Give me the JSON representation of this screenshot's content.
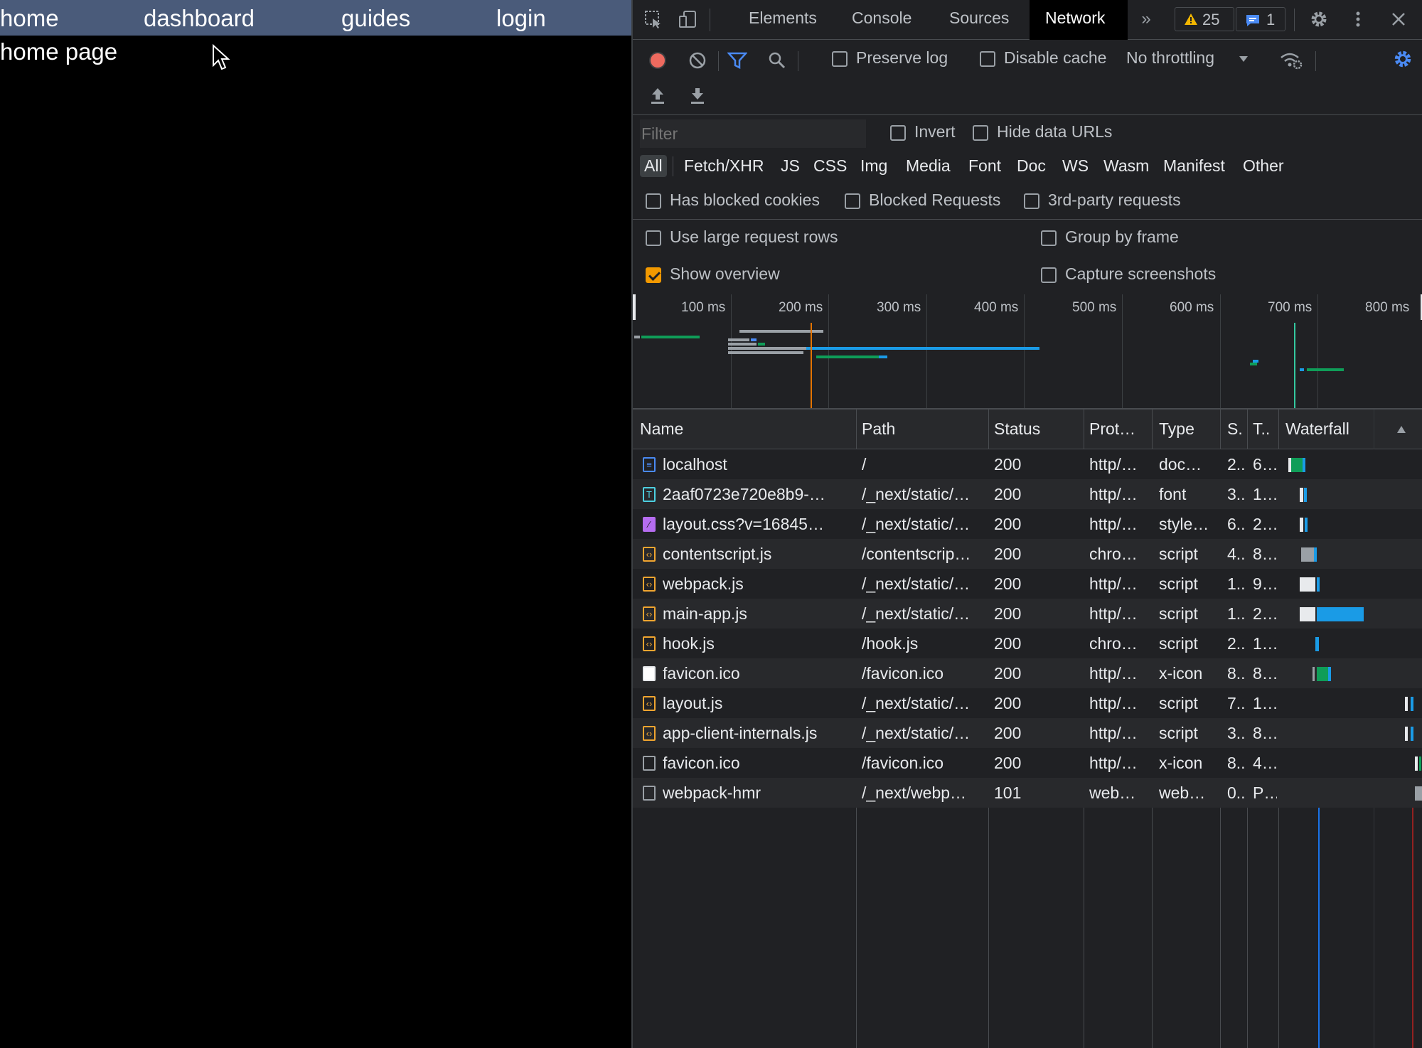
{
  "app": {
    "nav": [
      "home",
      "dashboard",
      "guides",
      "login"
    ],
    "title": "home page"
  },
  "devtools": {
    "tabs": [
      "Elements",
      "Console",
      "Sources",
      "Network"
    ],
    "active_tab": "Network",
    "warnings_count": "25",
    "messages_count": "1",
    "toolbar": {
      "preserve_log": "Preserve log",
      "disable_cache": "Disable cache",
      "throttling": "No throttling"
    },
    "filter": {
      "placeholder": "Filter",
      "invert": "Invert",
      "hide_data_urls": "Hide data URLs"
    },
    "types": [
      "All",
      "Fetch/XHR",
      "JS",
      "CSS",
      "Img",
      "Media",
      "Font",
      "Doc",
      "WS",
      "Wasm",
      "Manifest",
      "Other"
    ],
    "options": {
      "has_blocked_cookies": "Has blocked cookies",
      "blocked_requests": "Blocked Requests",
      "third_party": "3rd-party requests",
      "large_rows": "Use large request rows",
      "group_by_frame": "Group by frame",
      "show_overview": "Show overview",
      "capture_screenshots": "Capture screenshots"
    },
    "overview_ticks": [
      "100 ms",
      "200 ms",
      "300 ms",
      "400 ms",
      "500 ms",
      "600 ms",
      "700 ms",
      "800 ms"
    ],
    "columns": [
      "Name",
      "Path",
      "Status",
      "Prot…",
      "Type",
      "S.",
      "T..",
      "Waterfall"
    ],
    "colors": {
      "doc": "#4a8af4",
      "font": "#4dd0e1",
      "style": "#b56cf0",
      "script": "#f0a530",
      "waiting": "#0f9d58",
      "download": "#1a9be6"
    },
    "requests": [
      {
        "icon": "doc",
        "name": "localhost",
        "path": "/",
        "status": "200",
        "protocol": "http/…",
        "type": "doc…",
        "size": "2..",
        "time": "6…"
      },
      {
        "icon": "font",
        "name": "2aaf0723e720e8b9-…",
        "path": "/_next/static/…",
        "status": "200",
        "protocol": "http/…",
        "type": "font",
        "size": "3..",
        "time": "1…"
      },
      {
        "icon": "style",
        "name": "layout.css?v=16845…",
        "path": "/_next/static/…",
        "status": "200",
        "protocol": "http/…",
        "type": "style…",
        "size": "6..",
        "time": "2…"
      },
      {
        "icon": "script",
        "name": "contentscript.js",
        "path": "/contentscrip…",
        "status": "200",
        "protocol": "chro…",
        "type": "script",
        "size": "4..",
        "time": "8…"
      },
      {
        "icon": "script",
        "name": "webpack.js",
        "path": "/_next/static/…",
        "status": "200",
        "protocol": "http/…",
        "type": "script",
        "size": "1..",
        "time": "9…"
      },
      {
        "icon": "script",
        "name": "main-app.js",
        "path": "/_next/static/…",
        "status": "200",
        "protocol": "http/…",
        "type": "script",
        "size": "1..",
        "time": "2…"
      },
      {
        "icon": "script",
        "name": "hook.js",
        "path": "/hook.js",
        "status": "200",
        "protocol": "chro…",
        "type": "script",
        "size": "2..",
        "time": "1…"
      },
      {
        "icon": "image",
        "name": "favicon.ico",
        "path": "/favicon.ico",
        "status": "200",
        "protocol": "http/…",
        "type": "x-icon",
        "size": "8..",
        "time": "8…"
      },
      {
        "icon": "script",
        "name": "layout.js",
        "path": "/_next/static/…",
        "status": "200",
        "protocol": "http/…",
        "type": "script",
        "size": "7..",
        "time": "1…"
      },
      {
        "icon": "script",
        "name": "app-client-internals.js",
        "path": "/_next/static/…",
        "status": "200",
        "protocol": "http/…",
        "type": "script",
        "size": "3..",
        "time": "8…"
      },
      {
        "icon": "blank",
        "name": "favicon.ico",
        "path": "/favicon.ico",
        "status": "200",
        "protocol": "http/…",
        "type": "x-icon",
        "size": "8..",
        "time": "4…"
      },
      {
        "icon": "blank",
        "name": "webpack-hmr",
        "path": "/_next/webp…",
        "status": "101",
        "protocol": "web…",
        "type": "web…",
        "size": "0..",
        "time": "P…"
      }
    ]
  }
}
